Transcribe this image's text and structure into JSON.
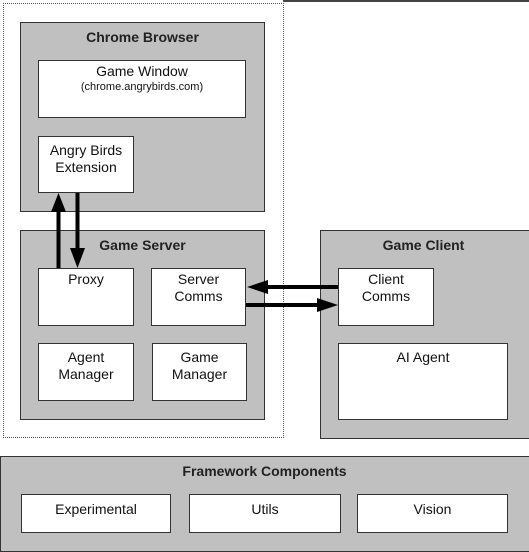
{
  "chrome_browser": {
    "title": "Chrome Browser",
    "game_window": {
      "label": "Game Window",
      "subtitle": "(chrome.angrybirds.com)"
    },
    "extension": {
      "line1": "Angry Birds",
      "line2": "Extension"
    }
  },
  "game_server": {
    "title": "Game Server",
    "proxy": "Proxy",
    "server_comms": {
      "line1": "Server",
      "line2": "Comms"
    },
    "agent_manager": {
      "line1": "Agent",
      "line2": "Manager"
    },
    "game_manager": {
      "line1": "Game",
      "line2": "Manager"
    }
  },
  "game_client": {
    "title": "Game Client",
    "client_comms": {
      "line1": "Client",
      "line2": "Comms"
    },
    "ai_agent": "AI Agent"
  },
  "framework": {
    "title": "Framework Components",
    "items": [
      "Experimental",
      "Utils",
      "Vision"
    ]
  },
  "colors": {
    "group_fill": "#c0c0c0",
    "box_fill": "#ffffff",
    "stroke": "#333333"
  }
}
